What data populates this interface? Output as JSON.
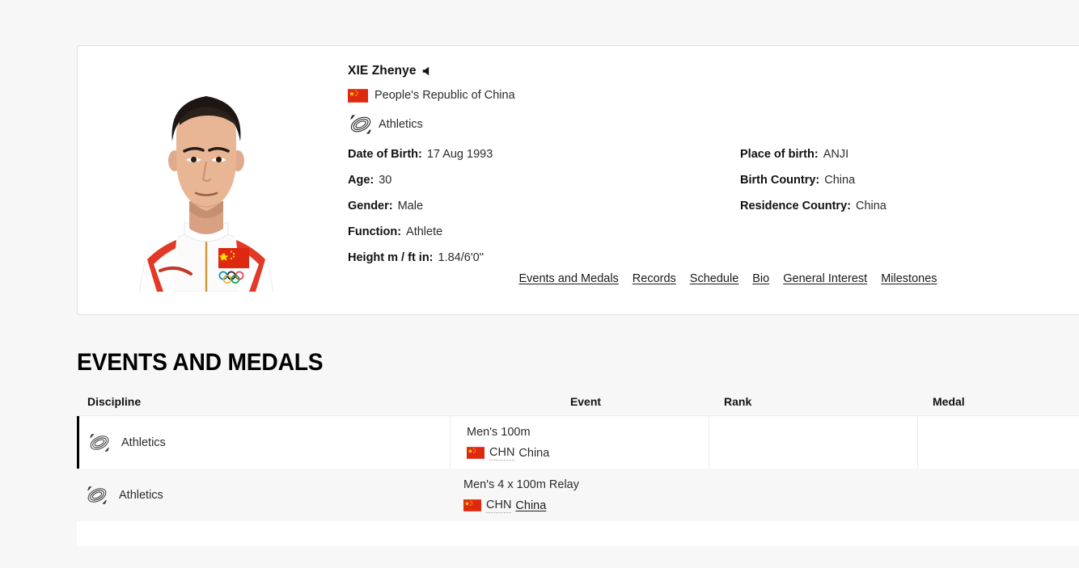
{
  "athlete": {
    "name": "XIE Zhenye",
    "pronunciation_icon": "speaker-icon",
    "country": "People's Republic of China",
    "country_flag": "china-flag-icon",
    "sport": "Athletics",
    "sport_icon": "athletics-pictogram-icon",
    "fields_left": [
      {
        "label": "Date of Birth:",
        "value": "17 Aug 1993"
      },
      {
        "label": "Age:",
        "value": "30"
      },
      {
        "label": "Gender:",
        "value": "Male"
      },
      {
        "label": "Function:",
        "value": "Athlete"
      },
      {
        "label": "Height m / ft in:",
        "value": "1.84/6'0''"
      }
    ],
    "fields_right": [
      {
        "label": "Place of birth:",
        "value": "ANJI"
      },
      {
        "label": "Birth Country:",
        "value": "China"
      },
      {
        "label": "Residence Country:",
        "value": "China"
      }
    ],
    "tabs": [
      {
        "label": "Events and Medals"
      },
      {
        "label": "Records"
      },
      {
        "label": "Schedule"
      },
      {
        "label": "Bio"
      },
      {
        "label": "General Interest"
      },
      {
        "label": "Milestones"
      }
    ]
  },
  "events_section": {
    "title": "EVENTS AND MEDALS",
    "columns": {
      "discipline": "Discipline",
      "event": "Event",
      "rank": "Rank",
      "medal": "Medal"
    },
    "rows": [
      {
        "discipline": "Athletics",
        "discipline_icon": "athletics-pictogram-icon",
        "event": "Men's 100m",
        "noc_code": "CHN",
        "country": "China",
        "country_is_link": false,
        "rank": "",
        "medal": ""
      },
      {
        "discipline": "Athletics",
        "discipline_icon": "athletics-pictogram-icon",
        "event": "Men's 4 x 100m Relay",
        "noc_code": "CHN",
        "country": "China",
        "country_is_link": true,
        "rank": "",
        "medal": ""
      }
    ]
  },
  "colors": {
    "page_background": "#f7f7f7",
    "card_background": "#ffffff",
    "flag_red": "#de2910",
    "flag_yellow": "#ffde00",
    "row_accent": "#000000",
    "text": "#1a1a1a"
  }
}
